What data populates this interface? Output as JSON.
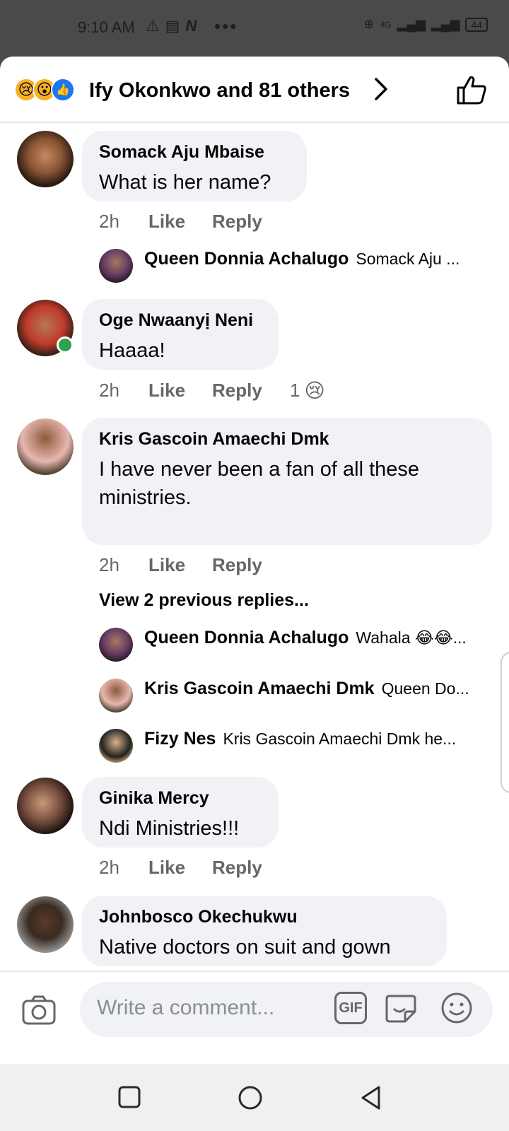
{
  "status": {
    "time": "9:10 AM",
    "battery": "44",
    "network": "4G"
  },
  "header": {
    "summary": "Ify Okonkwo and 81 others"
  },
  "comments": [
    {
      "name": "Somack Aju Mbaise",
      "text": "What is her name?",
      "time": "2h",
      "like": "Like",
      "reply": "Reply"
    },
    {
      "name": "Oge Nwaanyị Neni",
      "text": "Haaaa!",
      "time": "2h",
      "like": "Like",
      "reply": "Reply",
      "reaction_count": "1"
    },
    {
      "name": "Kris Gascoin Amaechi Dmk",
      "text": "I have never been a fan of all these ministries.",
      "time": "2h",
      "like": "Like",
      "reply": "Reply"
    },
    {
      "name": "Ginika Mercy",
      "text": "Ndi Ministries!!!",
      "time": "2h",
      "like": "Like",
      "reply": "Reply"
    },
    {
      "name": "Johnbosco Okechukwu",
      "text": "Native doctors on suit and gown"
    }
  ],
  "replies": [
    {
      "name": "Queen Donnia Achalugo",
      "text": "Somack Aju ..."
    },
    {
      "name": "Queen Donnia Achalugo",
      "text": "Wahala 😂😂..."
    },
    {
      "name": "Kris Gascoin Amaechi Dmk",
      "text": "Queen Do..."
    },
    {
      "name": "Fizy Nes",
      "text": "Kris Gascoin Amaechi Dmk he..."
    }
  ],
  "view_previous": "View 2 previous replies...",
  "composer": {
    "placeholder": "Write a comment...",
    "gif_label": "GIF"
  }
}
